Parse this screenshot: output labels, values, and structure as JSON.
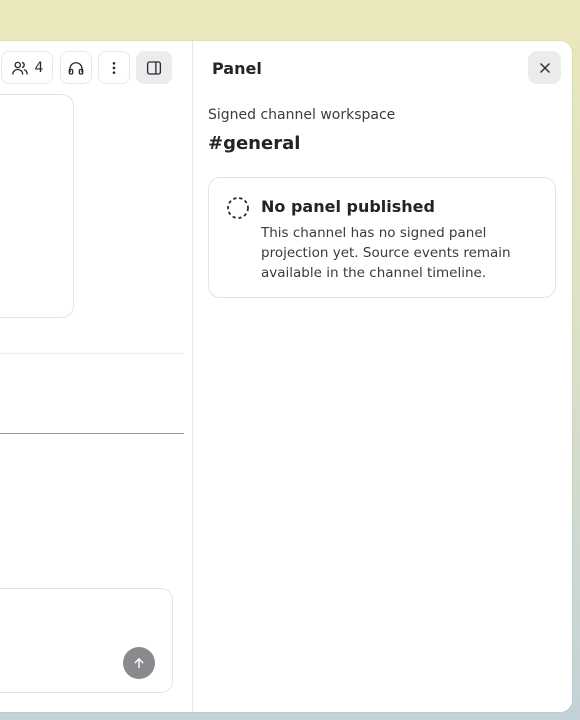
{
  "toolbar": {
    "members_count": "4"
  },
  "panel": {
    "title": "Panel",
    "subtitle": "Signed channel workspace",
    "channel": "#general",
    "empty_state": {
      "title": "No panel published",
      "description": "This channel has no signed panel projection yet. Source events remain available in the channel timeline."
    }
  }
}
